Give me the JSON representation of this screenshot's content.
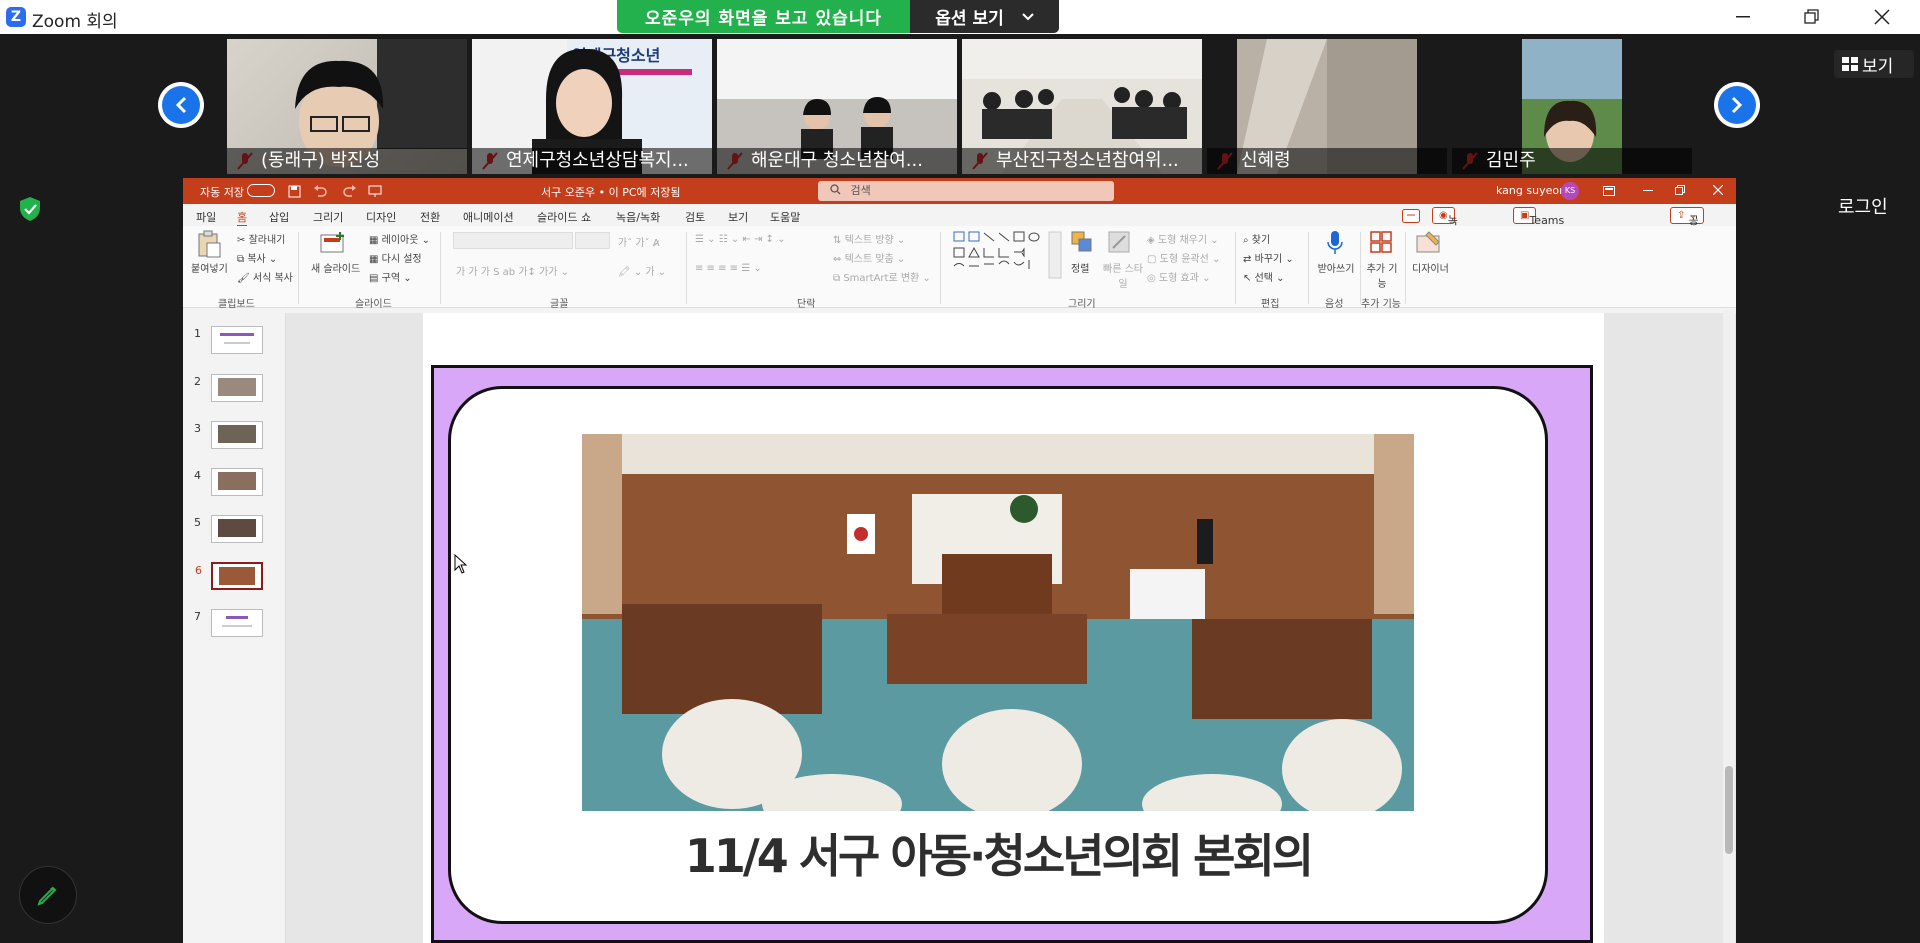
{
  "window": {
    "title": "Zoom 회의"
  },
  "share_banner": {
    "viewing": "오준우의 화면을 보고 있습니다",
    "options": "옵션 보기"
  },
  "participants": [
    {
      "name": "(동래구) 박진성"
    },
    {
      "name": "연제구청소년상담복지..."
    },
    {
      "name": "해운대구 청소년참여..."
    },
    {
      "name": "부산진구청소년참여위..."
    },
    {
      "name": "신혜령"
    },
    {
      "name": "김민주"
    }
  ],
  "participant_tile_banner": "연제구청소년",
  "top_right": {
    "view_label": "보기",
    "login_label": "로그인"
  },
  "ppt": {
    "autosave": "자동 저장",
    "doc_title": "서구 오준우 • 이 PC에 저장됨",
    "search_placeholder": "검색",
    "user": "kang suyeon",
    "user_initials": "KS",
    "tabs": [
      "파일",
      "홈",
      "삽입",
      "그리기",
      "디자인",
      "전환",
      "애니메이션",
      "슬라이드 쇼",
      "녹음/녹화",
      "검토",
      "보기",
      "도움말"
    ],
    "right_buttons": {
      "record": "녹음/녹화",
      "teams": "Teams에서 프레젠테이션",
      "share": "공유"
    },
    "ribbon": {
      "paste": "붙여넣기",
      "cut": "잘라내기",
      "copy": "복사",
      "format_painter": "서식 복사",
      "clipboard": "클립보드",
      "new_slide": "새 슬라이드",
      "layout": "레이아웃",
      "reset": "다시 설정",
      "section": "구역",
      "slides": "슬라이드",
      "font": "글꼴",
      "text_direction": "텍스트 방향",
      "align_text": "텍스트 맞춤",
      "smartart": "SmartArt로 변환",
      "paragraph": "단락",
      "arrange": "정렬",
      "quick_styles": "빠른 스타일",
      "shape_fill": "도형 채우기",
      "shape_outline": "도형 윤곽선",
      "shape_effects": "도형 효과",
      "drawing": "그리기",
      "find": "찾기",
      "replace": "바꾸기",
      "select": "선택",
      "editing": "편집",
      "dictate": "받아쓰기",
      "voice": "음성",
      "addins": "추가 기능",
      "addins_group": "추가 기능",
      "designer": "디자이너"
    },
    "slide_numbers": [
      "1",
      "2",
      "3",
      "4",
      "5",
      "6",
      "7"
    ],
    "current_slide": 6,
    "slide_caption": "11/4 서구 아동·청소년의회 본회의"
  },
  "colors": {
    "zoom_blue": "#2d6cf0",
    "banner_green": "#22b14c",
    "ppt_accent": "#c43e1c",
    "slide_border": "#d8a7f7"
  }
}
